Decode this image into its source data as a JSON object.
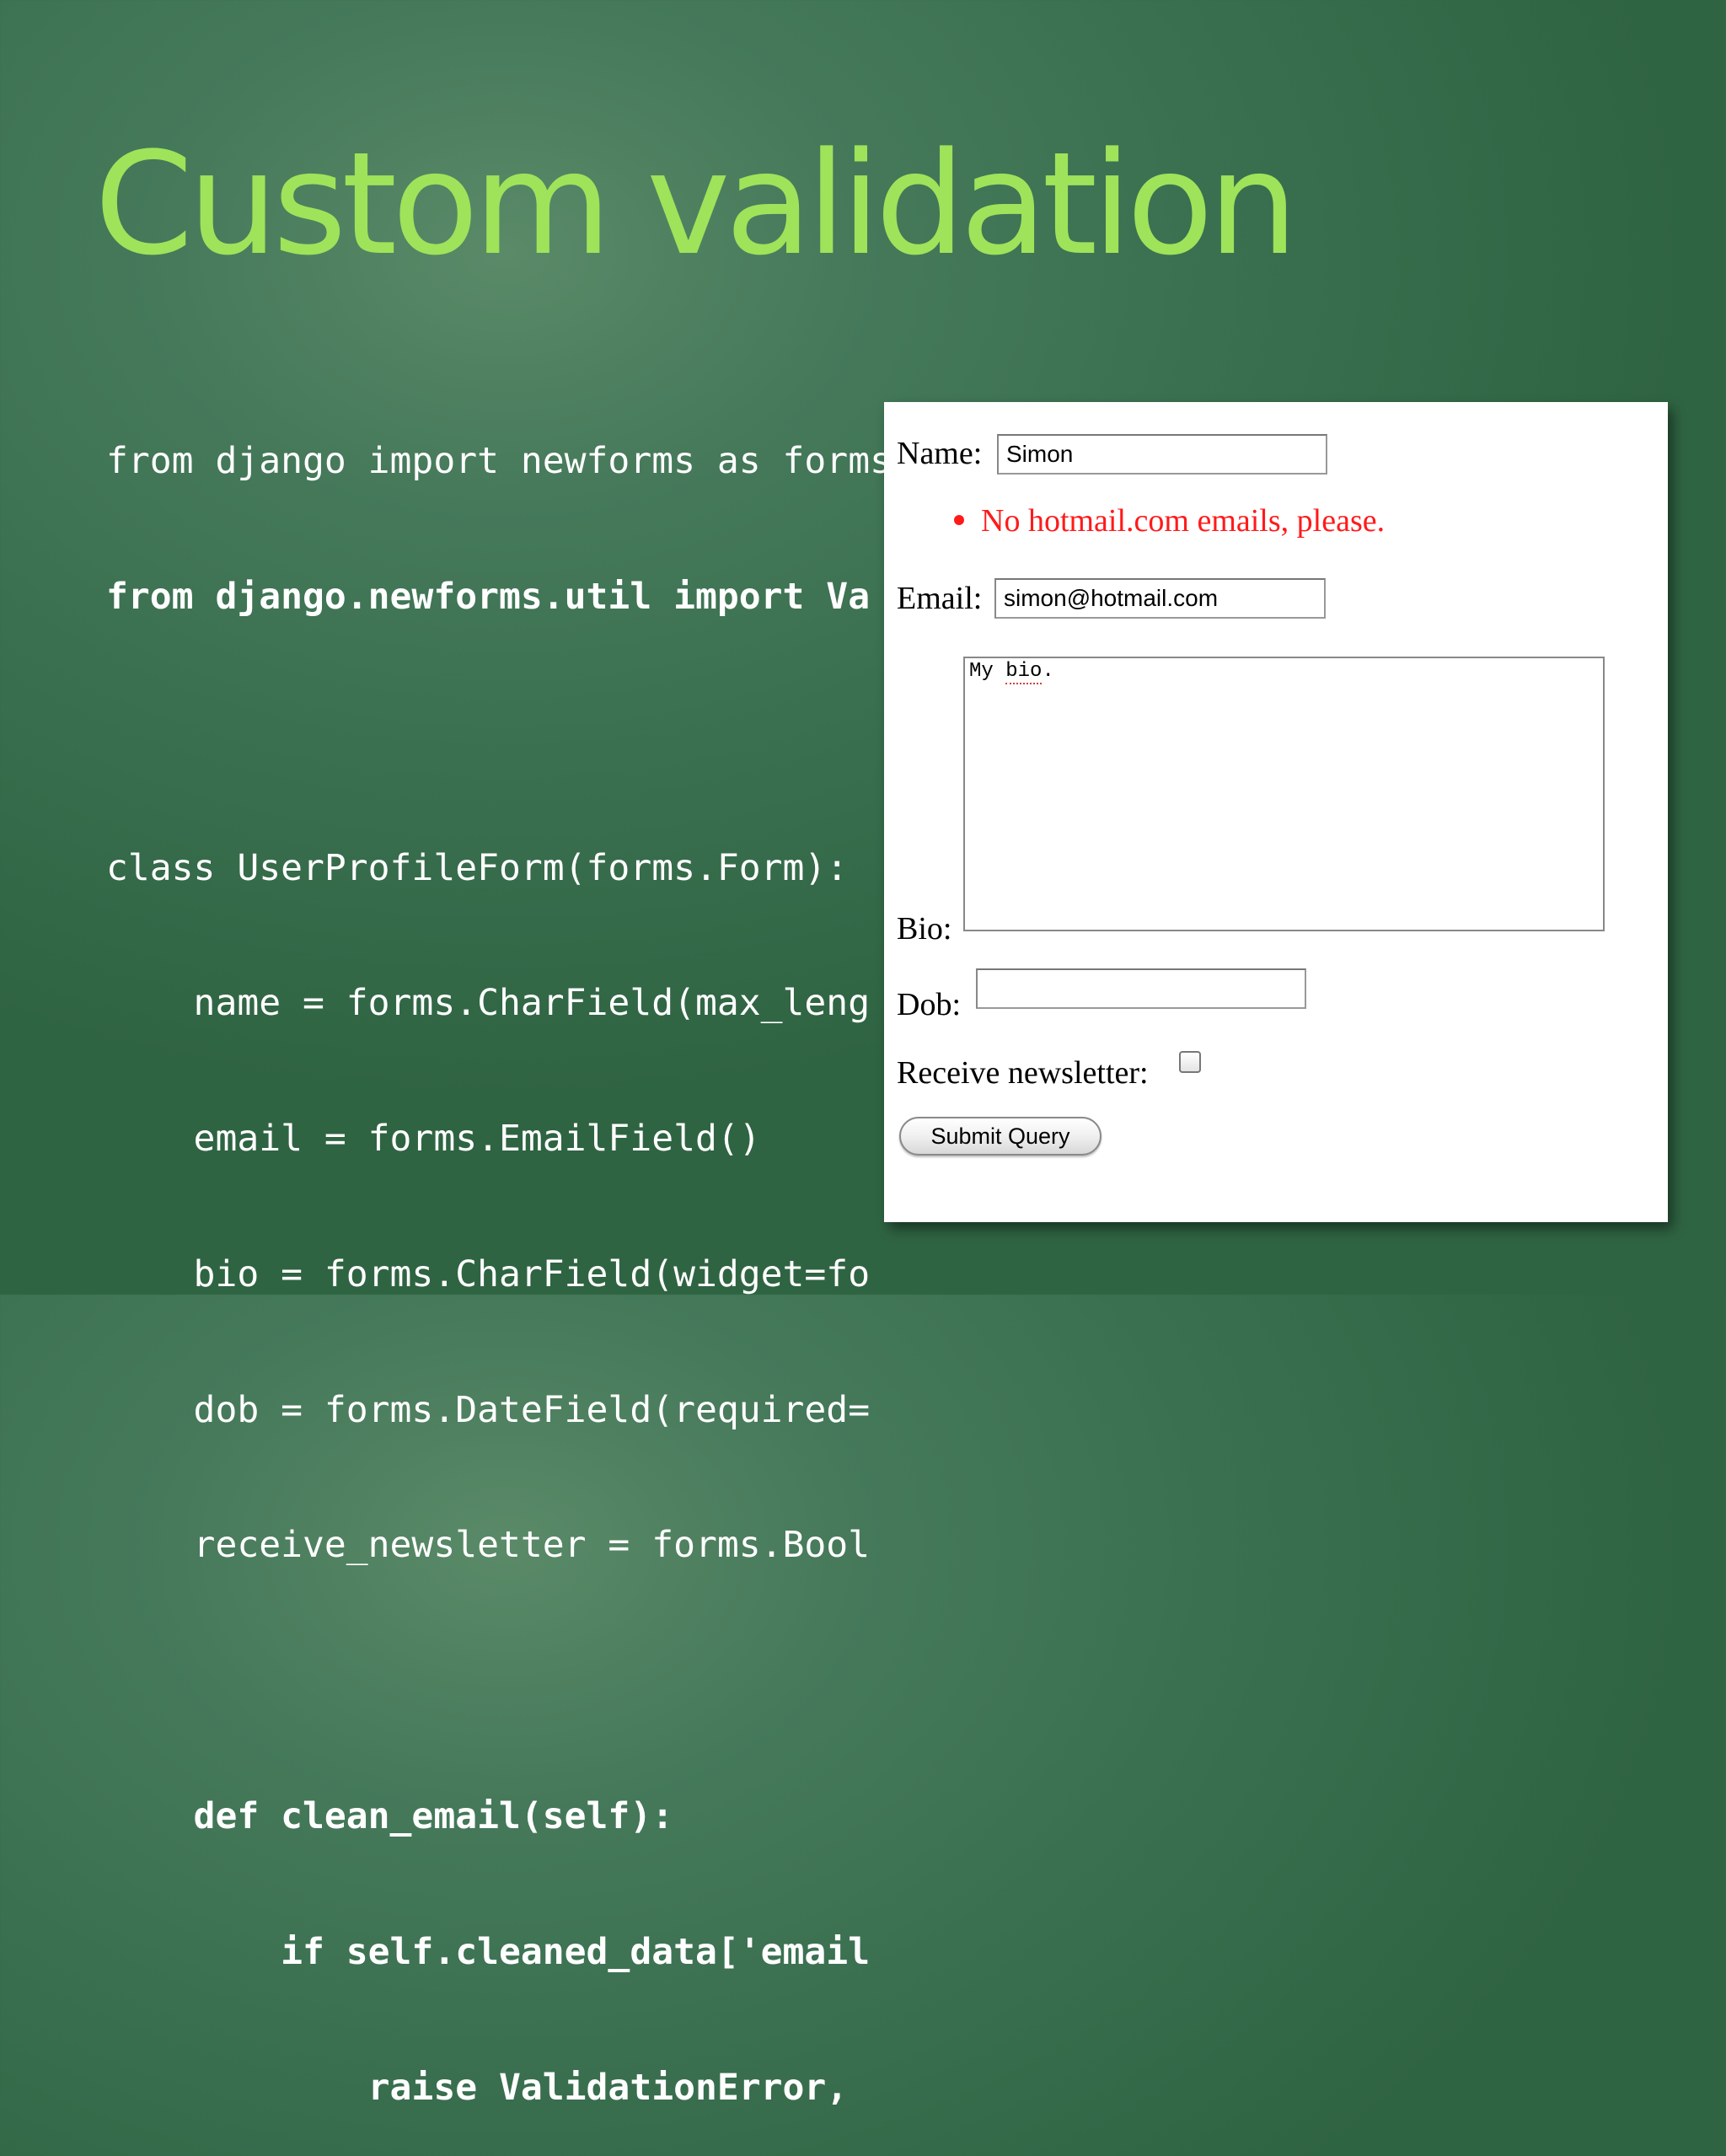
{
  "slide": {
    "title": "Custom validation"
  },
  "code": {
    "lines": [
      "from django import newforms as forms",
      "from django.newforms.util import Va",
      "",
      "class UserProfileForm(forms.Form):",
      "    name = forms.CharField(max_leng",
      "    email = forms.EmailField()",
      "    bio = forms.CharField(widget=fo",
      "    dob = forms.DateField(required=",
      "    receive_newsletter = forms.Bool",
      "",
      "    def clean_email(self):",
      "        if self.cleaned_data['email",
      "            raise ValidationError,"
    ]
  },
  "form": {
    "name_label": "Name:",
    "name_value": "Simon",
    "error_message": "No hotmail.com emails, please.",
    "email_label": "Email:",
    "email_value": "simon@hotmail.com",
    "bio_label": "Bio:",
    "bio_text_prefix": "My ",
    "bio_text_word": "bio",
    "bio_text_suffix": ".",
    "dob_label": "Dob:",
    "dob_value": "",
    "newsletter_label": "Receive newsletter:",
    "newsletter_checked": false,
    "submit_label": "Submit Query"
  },
  "colors": {
    "title": "#9ee35a",
    "error": "#ff1a1a",
    "background": "#3a7050"
  }
}
